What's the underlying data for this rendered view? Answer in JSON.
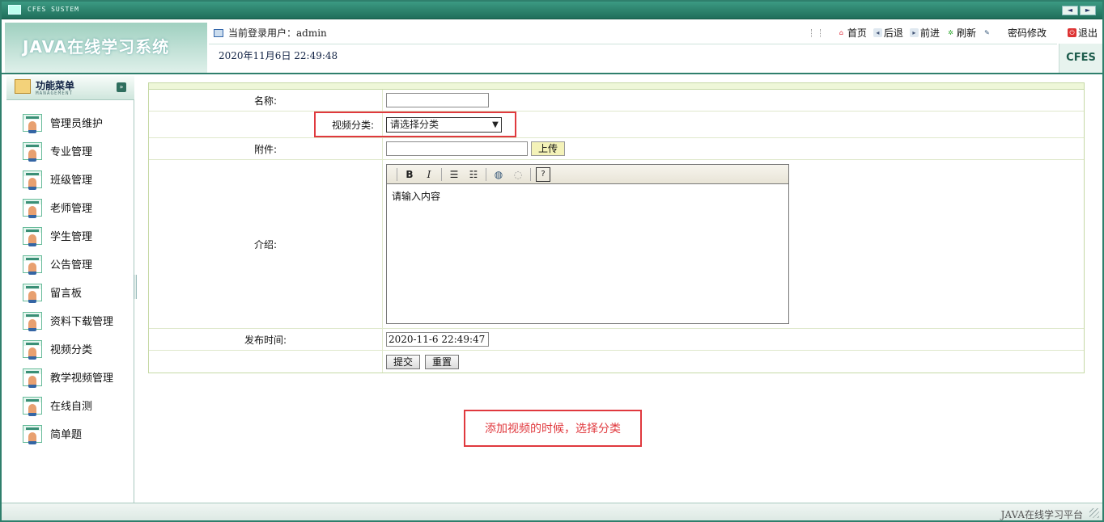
{
  "system": {
    "title": "CFES SUSTEM",
    "nav_prev": "◄",
    "nav_next": "►"
  },
  "header": {
    "app_title": "JAVA在线学习系统",
    "user_label": "当前登录用户：admin",
    "datetime": "2020年11月6日 22:49:48",
    "badge": "CFES",
    "toolbar": {
      "home": "首页",
      "back": "后退",
      "forward": "前进",
      "refresh": "刷新",
      "password": "密码修改",
      "logout": "退出"
    }
  },
  "sidebar": {
    "title": "功能菜单",
    "subtitle": "MANAGEMENT",
    "items": [
      {
        "label": "管理员维护"
      },
      {
        "label": "专业管理"
      },
      {
        "label": "班级管理"
      },
      {
        "label": "老师管理"
      },
      {
        "label": "学生管理"
      },
      {
        "label": "公告管理"
      },
      {
        "label": "留言板"
      },
      {
        "label": "资料下载管理"
      },
      {
        "label": "视频分类"
      },
      {
        "label": "教学视频管理"
      },
      {
        "label": "在线自测"
      },
      {
        "label": "简单题"
      }
    ]
  },
  "form": {
    "name_label": "名称:",
    "name_value": "",
    "category_label": "视频分类:",
    "category_selected": "请选择分类",
    "attachment_label": "附件:",
    "attachment_value": "",
    "upload_button": "上传",
    "intro_label": "介绍:",
    "editor_placeholder": "请输入内容",
    "publish_label": "发布时间:",
    "publish_value": "2020-11-6 22:49:47",
    "submit_button": "提交",
    "reset_button": "重置"
  },
  "annotation": {
    "note": "添加视频的时候，选择分类"
  },
  "status": {
    "text": "JAVA在线学习平台"
  },
  "colors": {
    "accent": "#2f7f6c",
    "highlight": "#e0393e"
  }
}
